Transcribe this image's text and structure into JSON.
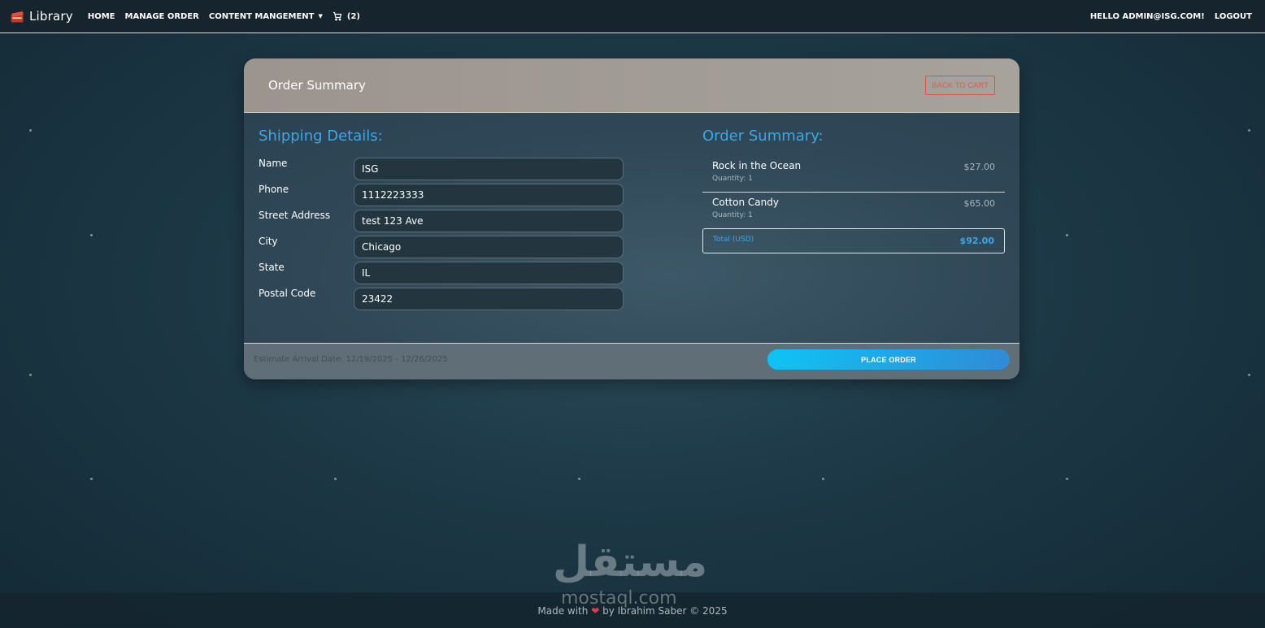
{
  "navbar": {
    "brand": "Library",
    "links": [
      "HOME",
      "MANAGE ORDER",
      "CONTENT MANGEMENT"
    ],
    "cart_count": "(2)",
    "greeting": "HELLO ADMIN@ISG.COM!",
    "logout": "LOGOUT"
  },
  "card": {
    "title": "Order Summary",
    "back_button": "BACK TO CART"
  },
  "shipping": {
    "heading": "Shipping Details:",
    "fields": [
      {
        "label": "Name",
        "value": "ISG"
      },
      {
        "label": "Phone",
        "value": "1112223333"
      },
      {
        "label": "Street Address",
        "value": "test 123 Ave"
      },
      {
        "label": "City",
        "value": "Chicago"
      },
      {
        "label": "State",
        "value": "IL"
      },
      {
        "label": "Postal Code",
        "value": "23422"
      }
    ]
  },
  "summary": {
    "heading": "Order Summary:",
    "items": [
      {
        "name": "Rock in the Ocean",
        "quantity": "Quantity: 1",
        "price": "$27.00"
      },
      {
        "name": "Cotton Candy",
        "quantity": "Quantity: 1",
        "price": "$65.00"
      }
    ],
    "total_label": "Total (USD)",
    "total_value": "$92.00"
  },
  "footer_bar": {
    "arrival": "Estimate Arrival Date: 12/19/2025 - 12/26/2025",
    "place_order": "PLACE ORDER"
  },
  "site_footer": {
    "made_with": "Made with",
    "by": "by Ibrahim Saber © 2025",
    "watermark_ar": "مستقل",
    "watermark_en": "mostaql.com"
  },
  "colors": {
    "accent": "#3ea7e6",
    "place_order_start": "#0fc3f5",
    "place_order_end": "#2f8bd8",
    "danger": "#e0574f"
  }
}
